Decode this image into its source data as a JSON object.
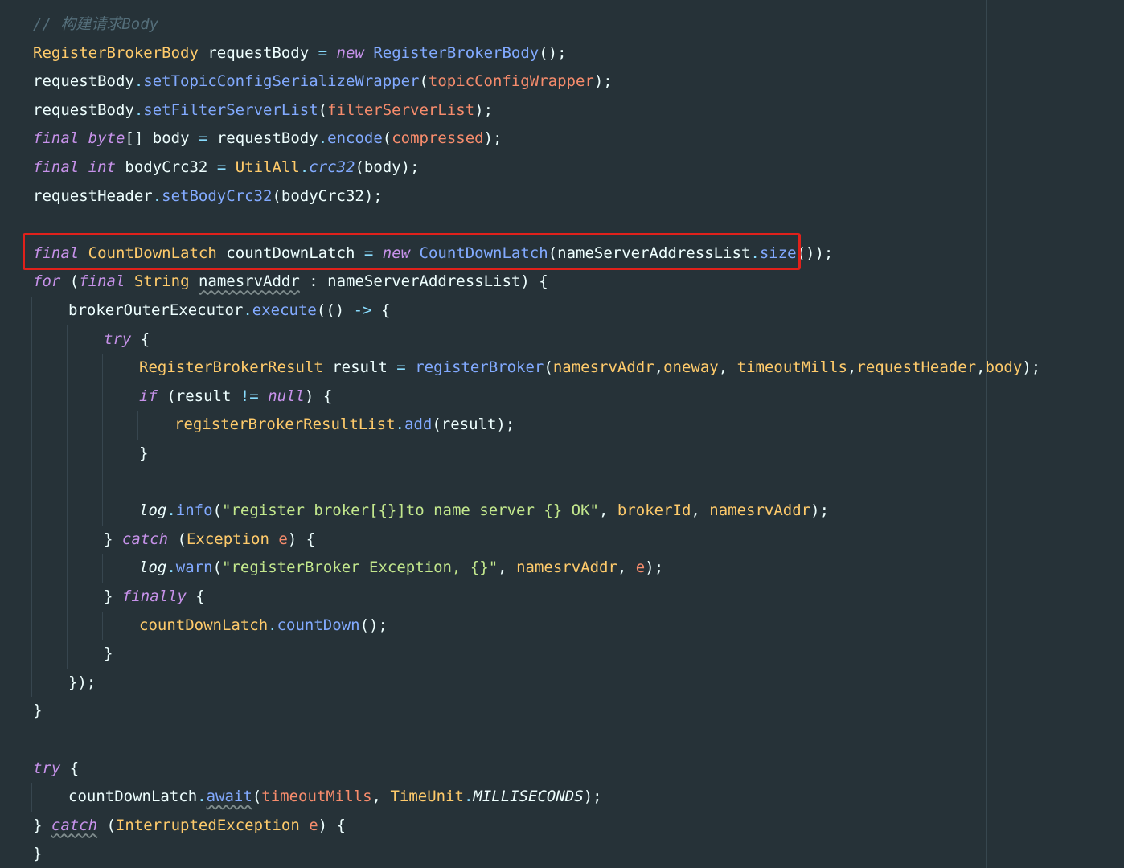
{
  "editor": {
    "highlight_color": "#e0211b",
    "background_color": "#263238",
    "lines": [
      {
        "indent": 0,
        "tokens": [
          {
            "t": "// 构建请求Body",
            "c": "comment"
          }
        ]
      },
      {
        "indent": 0,
        "tokens": [
          {
            "t": "RegisterBrokerBody",
            "c": "type"
          },
          {
            "t": " requestBody ",
            "c": "var"
          },
          {
            "t": "=",
            "c": "op"
          },
          {
            "t": " ",
            "c": "var"
          },
          {
            "t": "new",
            "c": "kw"
          },
          {
            "t": " ",
            "c": "var"
          },
          {
            "t": "RegisterBrokerBody",
            "c": "fn"
          },
          {
            "t": "();",
            "c": "punc"
          }
        ]
      },
      {
        "indent": 0,
        "tokens": [
          {
            "t": "requestBody",
            "c": "var"
          },
          {
            "t": ".",
            "c": "op"
          },
          {
            "t": "setTopicConfigSerializeWrapper",
            "c": "fn"
          },
          {
            "t": "(",
            "c": "punc"
          },
          {
            "t": "topicConfigWrapper",
            "c": "param"
          },
          {
            "t": ");",
            "c": "punc"
          }
        ]
      },
      {
        "indent": 0,
        "tokens": [
          {
            "t": "requestBody",
            "c": "var"
          },
          {
            "t": ".",
            "c": "op"
          },
          {
            "t": "setFilterServerList",
            "c": "fn"
          },
          {
            "t": "(",
            "c": "punc"
          },
          {
            "t": "filterServerList",
            "c": "param"
          },
          {
            "t": ");",
            "c": "punc"
          }
        ]
      },
      {
        "indent": 0,
        "tokens": [
          {
            "t": "final",
            "c": "kw"
          },
          {
            "t": " ",
            "c": "var"
          },
          {
            "t": "byte",
            "c": "kw"
          },
          {
            "t": "[]",
            "c": "punc"
          },
          {
            "t": " body ",
            "c": "var"
          },
          {
            "t": "=",
            "c": "op"
          },
          {
            "t": " requestBody",
            "c": "var"
          },
          {
            "t": ".",
            "c": "op"
          },
          {
            "t": "encode",
            "c": "fn"
          },
          {
            "t": "(",
            "c": "punc"
          },
          {
            "t": "compressed",
            "c": "param"
          },
          {
            "t": ");",
            "c": "punc"
          }
        ]
      },
      {
        "indent": 0,
        "tokens": [
          {
            "t": "final",
            "c": "kw"
          },
          {
            "t": " ",
            "c": "var"
          },
          {
            "t": "int",
            "c": "kw"
          },
          {
            "t": " bodyCrc32 ",
            "c": "var"
          },
          {
            "t": "=",
            "c": "op"
          },
          {
            "t": " ",
            "c": "var"
          },
          {
            "t": "UtilAll",
            "c": "type"
          },
          {
            "t": ".",
            "c": "op"
          },
          {
            "t": "crc32",
            "c": "static"
          },
          {
            "t": "(body);",
            "c": "punc"
          }
        ]
      },
      {
        "indent": 0,
        "tokens": [
          {
            "t": "requestHeader",
            "c": "var"
          },
          {
            "t": ".",
            "c": "op"
          },
          {
            "t": "setBodyCrc32",
            "c": "fn"
          },
          {
            "t": "(bodyCrc32);",
            "c": "punc"
          }
        ]
      },
      {
        "indent": 0,
        "tokens": []
      },
      {
        "indent": 0,
        "tokens": [
          {
            "t": "final",
            "c": "kw"
          },
          {
            "t": " ",
            "c": "var"
          },
          {
            "t": "CountDownLatch",
            "c": "type"
          },
          {
            "t": " countDownLatch ",
            "c": "var"
          },
          {
            "t": "=",
            "c": "op"
          },
          {
            "t": " ",
            "c": "var"
          },
          {
            "t": "new",
            "c": "kw"
          },
          {
            "t": " ",
            "c": "var"
          },
          {
            "t": "CountDownLatch",
            "c": "fn"
          },
          {
            "t": "(nameServerAddressList",
            "c": "punc"
          },
          {
            "t": ".",
            "c": "op"
          },
          {
            "t": "size",
            "c": "fn"
          },
          {
            "t": "());",
            "c": "punc"
          }
        ]
      },
      {
        "indent": 0,
        "tokens": [
          {
            "t": "for",
            "c": "kw"
          },
          {
            "t": " (",
            "c": "punc"
          },
          {
            "t": "final",
            "c": "kw"
          },
          {
            "t": " ",
            "c": "var"
          },
          {
            "t": "String",
            "c": "type"
          },
          {
            "t": " ",
            "c": "var"
          },
          {
            "t": "namesrvAddr",
            "c": "var",
            "w": true
          },
          {
            "t": " : nameServerAddressList) {",
            "c": "punc"
          }
        ]
      },
      {
        "indent": 1,
        "tokens": [
          {
            "t": "brokerOuterExecutor",
            "c": "var"
          },
          {
            "t": ".",
            "c": "op"
          },
          {
            "t": "execute",
            "c": "fn"
          },
          {
            "t": "(() ",
            "c": "punc"
          },
          {
            "t": "->",
            "c": "op"
          },
          {
            "t": " {",
            "c": "punc"
          }
        ]
      },
      {
        "indent": 2,
        "tokens": [
          {
            "t": "try",
            "c": "kw"
          },
          {
            "t": " {",
            "c": "punc"
          }
        ]
      },
      {
        "indent": 3,
        "tokens": [
          {
            "t": "RegisterBrokerResult",
            "c": "type"
          },
          {
            "t": " result ",
            "c": "var"
          },
          {
            "t": "=",
            "c": "op"
          },
          {
            "t": " ",
            "c": "var"
          },
          {
            "t": "registerBroker",
            "c": "fn"
          },
          {
            "t": "(",
            "c": "punc"
          },
          {
            "t": "namesrvAddr",
            "c": "field"
          },
          {
            "t": ",",
            "c": "punc"
          },
          {
            "t": "oneway",
            "c": "field"
          },
          {
            "t": ", ",
            "c": "punc"
          },
          {
            "t": "timeoutMills",
            "c": "field"
          },
          {
            "t": ",",
            "c": "punc"
          },
          {
            "t": "requestHeader",
            "c": "field"
          },
          {
            "t": ",",
            "c": "punc"
          },
          {
            "t": "body",
            "c": "field"
          },
          {
            "t": ");",
            "c": "punc"
          }
        ]
      },
      {
        "indent": 3,
        "tokens": [
          {
            "t": "if",
            "c": "kw"
          },
          {
            "t": " (result ",
            "c": "punc"
          },
          {
            "t": "!=",
            "c": "op"
          },
          {
            "t": " ",
            "c": "var"
          },
          {
            "t": "null",
            "c": "kw"
          },
          {
            "t": ") {",
            "c": "punc"
          }
        ]
      },
      {
        "indent": 4,
        "tokens": [
          {
            "t": "registerBrokerResultList",
            "c": "field"
          },
          {
            "t": ".",
            "c": "op"
          },
          {
            "t": "add",
            "c": "fn"
          },
          {
            "t": "(result);",
            "c": "punc"
          }
        ]
      },
      {
        "indent": 3,
        "tokens": [
          {
            "t": "}",
            "c": "punc"
          }
        ]
      },
      {
        "indent": 3,
        "tokens": []
      },
      {
        "indent": 3,
        "tokens": [
          {
            "t": "log",
            "c": "logvar"
          },
          {
            "t": ".",
            "c": "op"
          },
          {
            "t": "info",
            "c": "fn"
          },
          {
            "t": "(",
            "c": "punc"
          },
          {
            "t": "\"register broker[{}]to name server {} OK\"",
            "c": "str"
          },
          {
            "t": ", ",
            "c": "punc"
          },
          {
            "t": "brokerId",
            "c": "field"
          },
          {
            "t": ", ",
            "c": "punc"
          },
          {
            "t": "namesrvAddr",
            "c": "field"
          },
          {
            "t": ");",
            "c": "punc"
          }
        ]
      },
      {
        "indent": 2,
        "tokens": [
          {
            "t": "} ",
            "c": "punc"
          },
          {
            "t": "catch",
            "c": "kw"
          },
          {
            "t": " (",
            "c": "punc"
          },
          {
            "t": "Exception",
            "c": "type"
          },
          {
            "t": " ",
            "c": "var"
          },
          {
            "t": "e",
            "c": "param"
          },
          {
            "t": ") {",
            "c": "punc"
          }
        ]
      },
      {
        "indent": 3,
        "tokens": [
          {
            "t": "log",
            "c": "logvar"
          },
          {
            "t": ".",
            "c": "op"
          },
          {
            "t": "warn",
            "c": "fn"
          },
          {
            "t": "(",
            "c": "punc"
          },
          {
            "t": "\"registerBroker Exception, {}\"",
            "c": "str"
          },
          {
            "t": ", ",
            "c": "punc"
          },
          {
            "t": "namesrvAddr",
            "c": "field"
          },
          {
            "t": ", ",
            "c": "punc"
          },
          {
            "t": "e",
            "c": "param"
          },
          {
            "t": ");",
            "c": "punc"
          }
        ]
      },
      {
        "indent": 2,
        "tokens": [
          {
            "t": "} ",
            "c": "punc"
          },
          {
            "t": "finally",
            "c": "kw"
          },
          {
            "t": " {",
            "c": "punc"
          }
        ]
      },
      {
        "indent": 3,
        "tokens": [
          {
            "t": "countDownLatch",
            "c": "field"
          },
          {
            "t": ".",
            "c": "op"
          },
          {
            "t": "countDown",
            "c": "fn"
          },
          {
            "t": "();",
            "c": "punc"
          }
        ]
      },
      {
        "indent": 2,
        "tokens": [
          {
            "t": "}",
            "c": "punc"
          }
        ]
      },
      {
        "indent": 1,
        "tokens": [
          {
            "t": "});",
            "c": "punc"
          }
        ]
      },
      {
        "indent": 0,
        "tokens": [
          {
            "t": "}",
            "c": "punc"
          }
        ]
      },
      {
        "indent": 0,
        "tokens": []
      },
      {
        "indent": 0,
        "tokens": [
          {
            "t": "try",
            "c": "kw"
          },
          {
            "t": " {",
            "c": "punc"
          }
        ]
      },
      {
        "indent": 1,
        "tokens": [
          {
            "t": "countDownLatch",
            "c": "var"
          },
          {
            "t": ".",
            "c": "op"
          },
          {
            "t": "await",
            "c": "fn",
            "w": true
          },
          {
            "t": "(",
            "c": "punc"
          },
          {
            "t": "timeoutMills",
            "c": "param"
          },
          {
            "t": ", ",
            "c": "punc"
          },
          {
            "t": "TimeUnit",
            "c": "type"
          },
          {
            "t": ".",
            "c": "op"
          },
          {
            "t": "MILLISECONDS",
            "c": "const"
          },
          {
            "t": ");",
            "c": "punc"
          }
        ]
      },
      {
        "indent": 0,
        "tokens": [
          {
            "t": "} ",
            "c": "punc"
          },
          {
            "t": "catch",
            "c": "kw",
            "w": true
          },
          {
            "t": " (",
            "c": "punc"
          },
          {
            "t": "InterruptedException",
            "c": "type"
          },
          {
            "t": " ",
            "c": "var"
          },
          {
            "t": "e",
            "c": "param"
          },
          {
            "t": ") {",
            "c": "punc"
          }
        ]
      },
      {
        "indent": 0,
        "tokens": [
          {
            "t": "}",
            "c": "punc"
          }
        ]
      }
    ]
  }
}
